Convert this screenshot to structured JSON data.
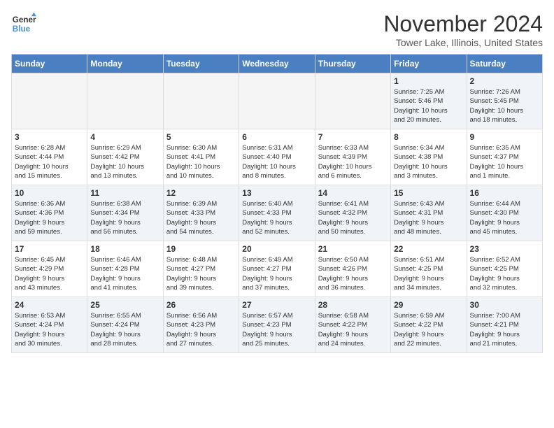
{
  "header": {
    "logo_line1": "General",
    "logo_line2": "Blue",
    "month": "November 2024",
    "location": "Tower Lake, Illinois, United States"
  },
  "weekdays": [
    "Sunday",
    "Monday",
    "Tuesday",
    "Wednesday",
    "Thursday",
    "Friday",
    "Saturday"
  ],
  "weeks": [
    [
      {
        "day": "",
        "info": ""
      },
      {
        "day": "",
        "info": ""
      },
      {
        "day": "",
        "info": ""
      },
      {
        "day": "",
        "info": ""
      },
      {
        "day": "",
        "info": ""
      },
      {
        "day": "1",
        "info": "Sunrise: 7:25 AM\nSunset: 5:46 PM\nDaylight: 10 hours\nand 20 minutes."
      },
      {
        "day": "2",
        "info": "Sunrise: 7:26 AM\nSunset: 5:45 PM\nDaylight: 10 hours\nand 18 minutes."
      }
    ],
    [
      {
        "day": "3",
        "info": "Sunrise: 6:28 AM\nSunset: 4:44 PM\nDaylight: 10 hours\nand 15 minutes."
      },
      {
        "day": "4",
        "info": "Sunrise: 6:29 AM\nSunset: 4:42 PM\nDaylight: 10 hours\nand 13 minutes."
      },
      {
        "day": "5",
        "info": "Sunrise: 6:30 AM\nSunset: 4:41 PM\nDaylight: 10 hours\nand 10 minutes."
      },
      {
        "day": "6",
        "info": "Sunrise: 6:31 AM\nSunset: 4:40 PM\nDaylight: 10 hours\nand 8 minutes."
      },
      {
        "day": "7",
        "info": "Sunrise: 6:33 AM\nSunset: 4:39 PM\nDaylight: 10 hours\nand 6 minutes."
      },
      {
        "day": "8",
        "info": "Sunrise: 6:34 AM\nSunset: 4:38 PM\nDaylight: 10 hours\nand 3 minutes."
      },
      {
        "day": "9",
        "info": "Sunrise: 6:35 AM\nSunset: 4:37 PM\nDaylight: 10 hours\nand 1 minute."
      }
    ],
    [
      {
        "day": "10",
        "info": "Sunrise: 6:36 AM\nSunset: 4:36 PM\nDaylight: 9 hours\nand 59 minutes."
      },
      {
        "day": "11",
        "info": "Sunrise: 6:38 AM\nSunset: 4:34 PM\nDaylight: 9 hours\nand 56 minutes."
      },
      {
        "day": "12",
        "info": "Sunrise: 6:39 AM\nSunset: 4:33 PM\nDaylight: 9 hours\nand 54 minutes."
      },
      {
        "day": "13",
        "info": "Sunrise: 6:40 AM\nSunset: 4:33 PM\nDaylight: 9 hours\nand 52 minutes."
      },
      {
        "day": "14",
        "info": "Sunrise: 6:41 AM\nSunset: 4:32 PM\nDaylight: 9 hours\nand 50 minutes."
      },
      {
        "day": "15",
        "info": "Sunrise: 6:43 AM\nSunset: 4:31 PM\nDaylight: 9 hours\nand 48 minutes."
      },
      {
        "day": "16",
        "info": "Sunrise: 6:44 AM\nSunset: 4:30 PM\nDaylight: 9 hours\nand 45 minutes."
      }
    ],
    [
      {
        "day": "17",
        "info": "Sunrise: 6:45 AM\nSunset: 4:29 PM\nDaylight: 9 hours\nand 43 minutes."
      },
      {
        "day": "18",
        "info": "Sunrise: 6:46 AM\nSunset: 4:28 PM\nDaylight: 9 hours\nand 41 minutes."
      },
      {
        "day": "19",
        "info": "Sunrise: 6:48 AM\nSunset: 4:27 PM\nDaylight: 9 hours\nand 39 minutes."
      },
      {
        "day": "20",
        "info": "Sunrise: 6:49 AM\nSunset: 4:27 PM\nDaylight: 9 hours\nand 37 minutes."
      },
      {
        "day": "21",
        "info": "Sunrise: 6:50 AM\nSunset: 4:26 PM\nDaylight: 9 hours\nand 36 minutes."
      },
      {
        "day": "22",
        "info": "Sunrise: 6:51 AM\nSunset: 4:25 PM\nDaylight: 9 hours\nand 34 minutes."
      },
      {
        "day": "23",
        "info": "Sunrise: 6:52 AM\nSunset: 4:25 PM\nDaylight: 9 hours\nand 32 minutes."
      }
    ],
    [
      {
        "day": "24",
        "info": "Sunrise: 6:53 AM\nSunset: 4:24 PM\nDaylight: 9 hours\nand 30 minutes."
      },
      {
        "day": "25",
        "info": "Sunrise: 6:55 AM\nSunset: 4:24 PM\nDaylight: 9 hours\nand 28 minutes."
      },
      {
        "day": "26",
        "info": "Sunrise: 6:56 AM\nSunset: 4:23 PM\nDaylight: 9 hours\nand 27 minutes."
      },
      {
        "day": "27",
        "info": "Sunrise: 6:57 AM\nSunset: 4:23 PM\nDaylight: 9 hours\nand 25 minutes."
      },
      {
        "day": "28",
        "info": "Sunrise: 6:58 AM\nSunset: 4:22 PM\nDaylight: 9 hours\nand 24 minutes."
      },
      {
        "day": "29",
        "info": "Sunrise: 6:59 AM\nSunset: 4:22 PM\nDaylight: 9 hours\nand 22 minutes."
      },
      {
        "day": "30",
        "info": "Sunrise: 7:00 AM\nSunset: 4:21 PM\nDaylight: 9 hours\nand 21 minutes."
      }
    ]
  ]
}
